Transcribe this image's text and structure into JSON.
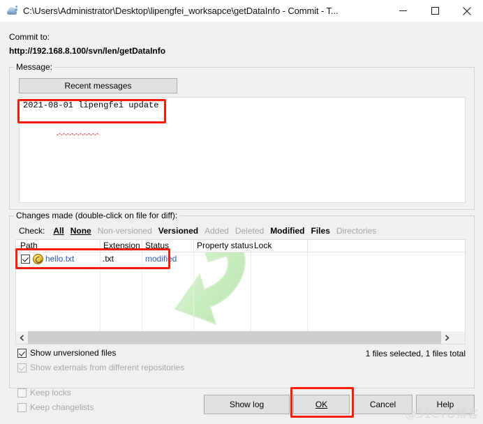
{
  "window": {
    "title": "C:\\Users\\Administrator\\Desktop\\lipengfei_worksapce\\getDataInfo - Commit - T...",
    "icon": "tortoisesvn-turtle-icon",
    "minimize_label": "Minimize",
    "maximize_label": "Maximize",
    "close_label": "Close"
  },
  "commit_to": {
    "label": "Commit to:",
    "url": "http://192.168.8.100/svn/len/getDataInfo"
  },
  "message_group": {
    "title": "Message:",
    "recent_messages_button": "Recent messages",
    "message_value": "2021-08-01 lipengfei update",
    "message_placeholder": ""
  },
  "changes_group": {
    "title": "Changes made (double-click on file for diff):",
    "check_label": "Check:",
    "check_links": [
      {
        "label": "All",
        "enabled": true
      },
      {
        "label": "None",
        "enabled": true
      },
      {
        "label": "Non-versioned",
        "enabled": false
      },
      {
        "label": "Versioned",
        "enabled": true
      },
      {
        "label": "Added",
        "enabled": false
      },
      {
        "label": "Deleted",
        "enabled": false
      },
      {
        "label": "Modified",
        "enabled": true
      },
      {
        "label": "Files",
        "enabled": true
      },
      {
        "label": "Directories",
        "enabled": false
      }
    ],
    "columns": [
      "Path",
      "Extension",
      "Status",
      "Property status",
      "Lock"
    ],
    "rows": [
      {
        "checked": true,
        "icon": "modified-file-icon",
        "path": "hello.txt",
        "extension": ".txt",
        "status": "modified",
        "property_status": "",
        "lock": ""
      }
    ],
    "status_text": "1 files selected, 1 files total",
    "show_unversioned": {
      "label": "Show unversioned files",
      "checked": true,
      "enabled": true
    },
    "show_externals": {
      "label": "Show externals from different repositories",
      "checked": true,
      "enabled": false
    }
  },
  "footer": {
    "keep_locks": {
      "label": "Keep locks",
      "checked": false,
      "enabled": false
    },
    "keep_changelists": {
      "label": "Keep changelists",
      "checked": false,
      "enabled": false
    },
    "buttons": [
      {
        "label": "Show log",
        "accel": "",
        "highlighted": false
      },
      {
        "label": "OK",
        "accel": "O",
        "highlighted": true
      },
      {
        "label": "Cancel",
        "accel": "",
        "highlighted": false
      },
      {
        "label": "Help",
        "accel": "",
        "highlighted": false
      }
    ]
  },
  "watermark": {
    "text": "@51CTO博客",
    "arrow": "tortoisesvn-arrow-watermark"
  },
  "colors": {
    "annotation_red": "#fb1b06",
    "link_blue": "#2a5fbd",
    "window_bg": "#f0f0f0",
    "field_bg": "#ffffff",
    "disabled_text": "#a6a6a6",
    "watermark_green": "#c9edc2"
  }
}
